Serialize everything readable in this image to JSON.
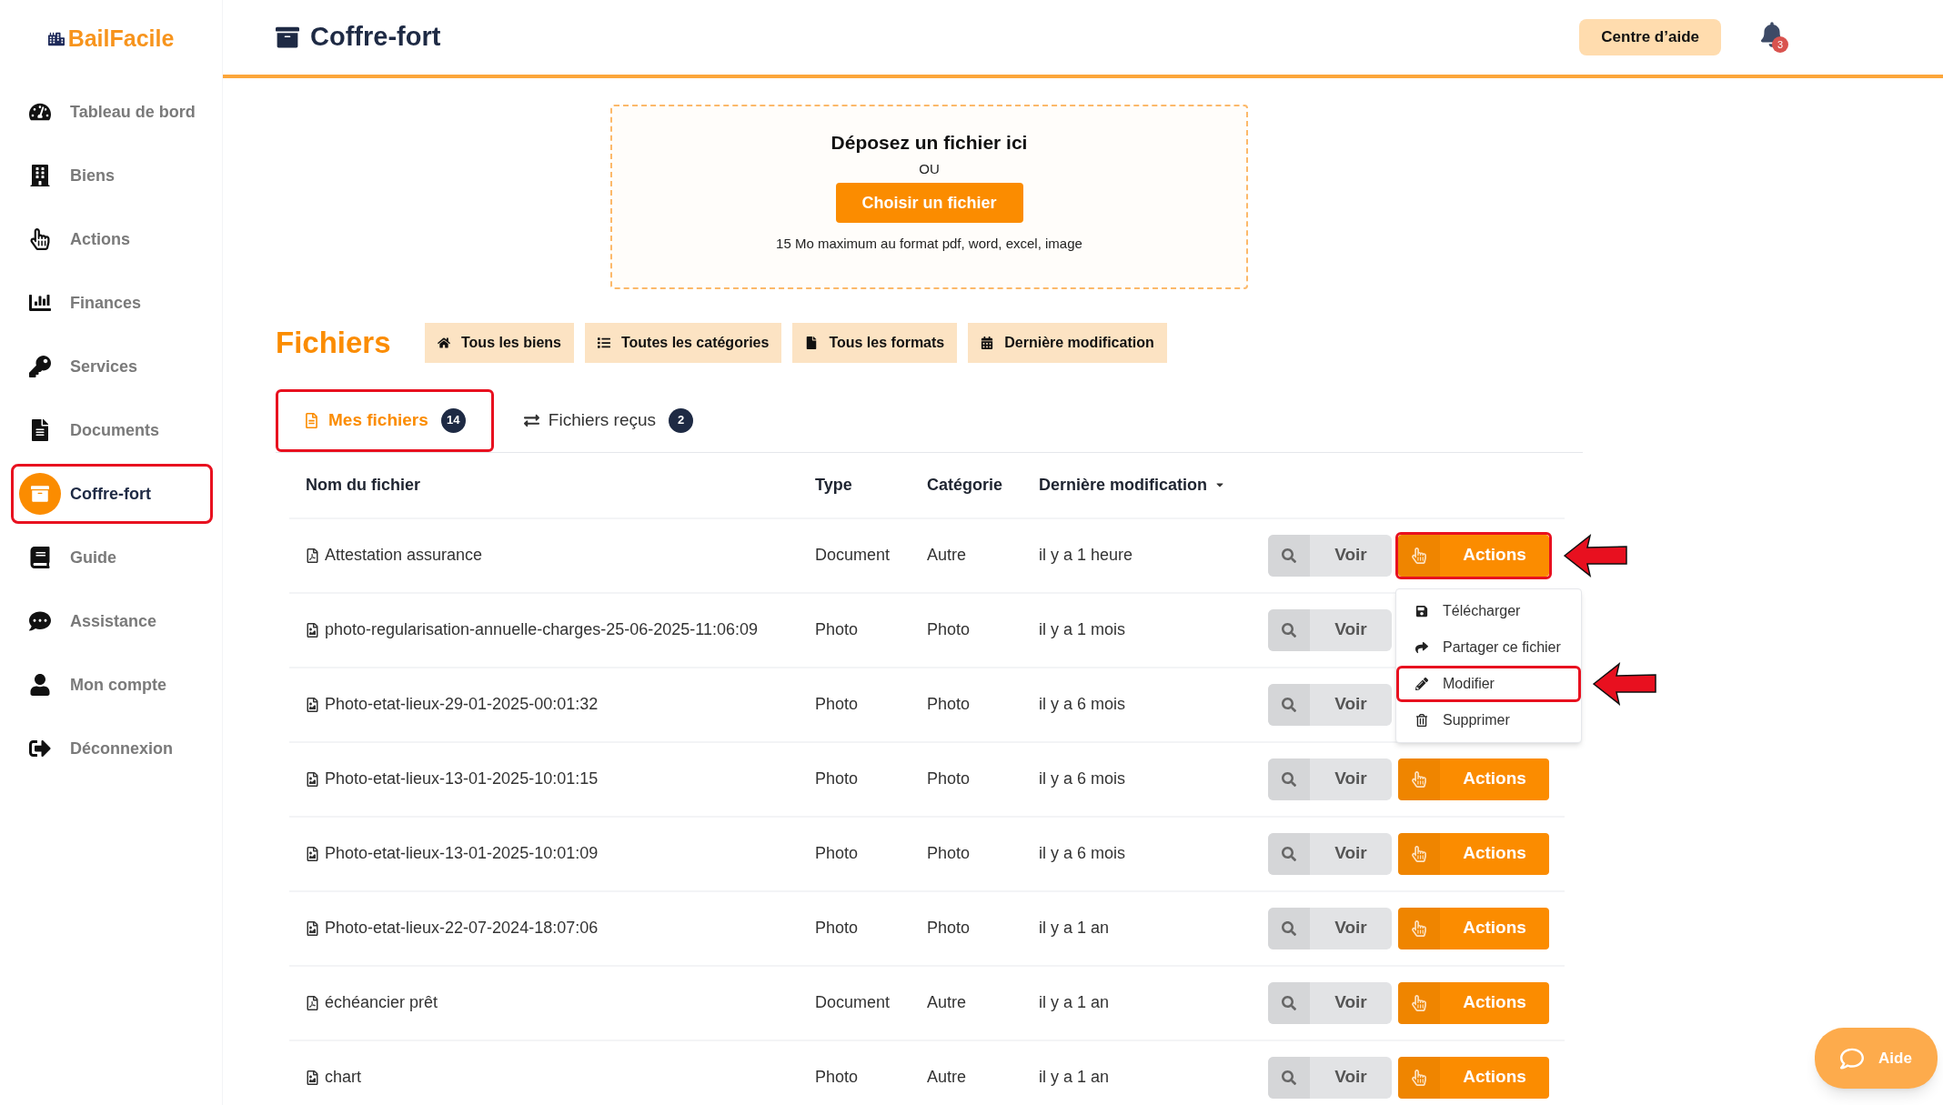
{
  "brand": {
    "name": "BailFacile"
  },
  "sidebar": {
    "items": [
      {
        "label": "Tableau de bord",
        "selected": false,
        "highlighted": false
      },
      {
        "label": "Biens",
        "selected": false,
        "highlighted": false
      },
      {
        "label": "Actions",
        "selected": false,
        "highlighted": false
      },
      {
        "label": "Finances",
        "selected": false,
        "highlighted": false
      },
      {
        "label": "Services",
        "selected": false,
        "highlighted": false
      },
      {
        "label": "Documents",
        "selected": false,
        "highlighted": false
      },
      {
        "label": "Coffre-fort",
        "selected": true,
        "highlighted": true
      },
      {
        "label": "Guide",
        "selected": false,
        "highlighted": false
      },
      {
        "label": "Assistance",
        "selected": false,
        "highlighted": false
      },
      {
        "label": "Mon compte",
        "selected": false,
        "highlighted": false
      },
      {
        "label": "Déconnexion",
        "selected": false,
        "highlighted": false
      }
    ]
  },
  "header": {
    "title": "Coffre-fort",
    "help_button": "Centre d’aide",
    "notifications": "3"
  },
  "upload": {
    "title": "Déposez un fichier ici",
    "separator": "OU",
    "button": "Choisir un fichier",
    "hint": "15 Mo maximum au format pdf, word, excel, image"
  },
  "files": {
    "title": "Fichiers",
    "filters": [
      "Tous les biens",
      "Toutes les catégories",
      "Tous les formats",
      "Dernière modification"
    ],
    "tabs": [
      {
        "label": "Mes fichiers",
        "count": "14",
        "selected": true,
        "highlighted": true
      },
      {
        "label": "Fichiers reçus",
        "count": "2",
        "selected": false,
        "highlighted": false
      }
    ],
    "table": {
      "columns": [
        {
          "label": "Nom du fichier",
          "sorted": false
        },
        {
          "label": "Type",
          "sorted": false
        },
        {
          "label": "Catégorie",
          "sorted": false
        },
        {
          "label": "Dernière modification",
          "sorted": true
        }
      ],
      "rows": [
        {
          "kind": "pdf",
          "name": "Attestation assurance",
          "type": "Document",
          "category": "Autre",
          "modified": "il y a 1 heure",
          "view": "Voir",
          "actions": "Actions",
          "highlighted": true,
          "arrow": true,
          "menu": [
            {
              "label": "Télécharger",
              "highlighted": false,
              "arrow": false
            },
            {
              "label": "Partager ce fichier",
              "highlighted": false,
              "arrow": false
            },
            {
              "label": "Modifier",
              "highlighted": true,
              "arrow": true
            },
            {
              "label": "Supprimer",
              "highlighted": false,
              "arrow": false
            }
          ]
        },
        {
          "kind": "image",
          "name": "photo-regularisation-annuelle-charges-25-06-2025-11:06:09",
          "type": "Photo",
          "category": "Photo",
          "modified": "il y a 1 mois",
          "view": "Voir",
          "arrow": false
        },
        {
          "kind": "image",
          "name": "Photo-etat-lieux-29-01-2025-00:01:32",
          "type": "Photo",
          "category": "Photo",
          "modified": "il y a 6 mois",
          "view": "Voir",
          "arrow": false
        },
        {
          "kind": "image",
          "name": "Photo-etat-lieux-13-01-2025-10:01:15",
          "type": "Photo",
          "category": "Photo",
          "modified": "il y a 6 mois",
          "view": "Voir",
          "actions": "Actions",
          "highlighted": false,
          "arrow": false
        },
        {
          "kind": "image",
          "name": "Photo-etat-lieux-13-01-2025-10:01:09",
          "type": "Photo",
          "category": "Photo",
          "modified": "il y a 6 mois",
          "view": "Voir",
          "actions": "Actions",
          "highlighted": false,
          "arrow": false
        },
        {
          "kind": "image",
          "name": "Photo-etat-lieux-22-07-2024-18:07:06",
          "type": "Photo",
          "category": "Photo",
          "modified": "il y a 1 an",
          "view": "Voir",
          "actions": "Actions",
          "highlighted": false,
          "arrow": false
        },
        {
          "kind": "pdf",
          "name": "échéancier prêt",
          "type": "Document",
          "category": "Autre",
          "modified": "il y a 1 an",
          "view": "Voir",
          "actions": "Actions",
          "highlighted": false,
          "arrow": false
        },
        {
          "kind": "image",
          "name": "chart",
          "type": "Photo",
          "category": "Autre",
          "modified": "il y a 1 an",
          "view": "Voir",
          "actions": "Actions",
          "highlighted": false,
          "arrow": false
        }
      ]
    }
  },
  "help_widget": {
    "label": "Aide"
  }
}
